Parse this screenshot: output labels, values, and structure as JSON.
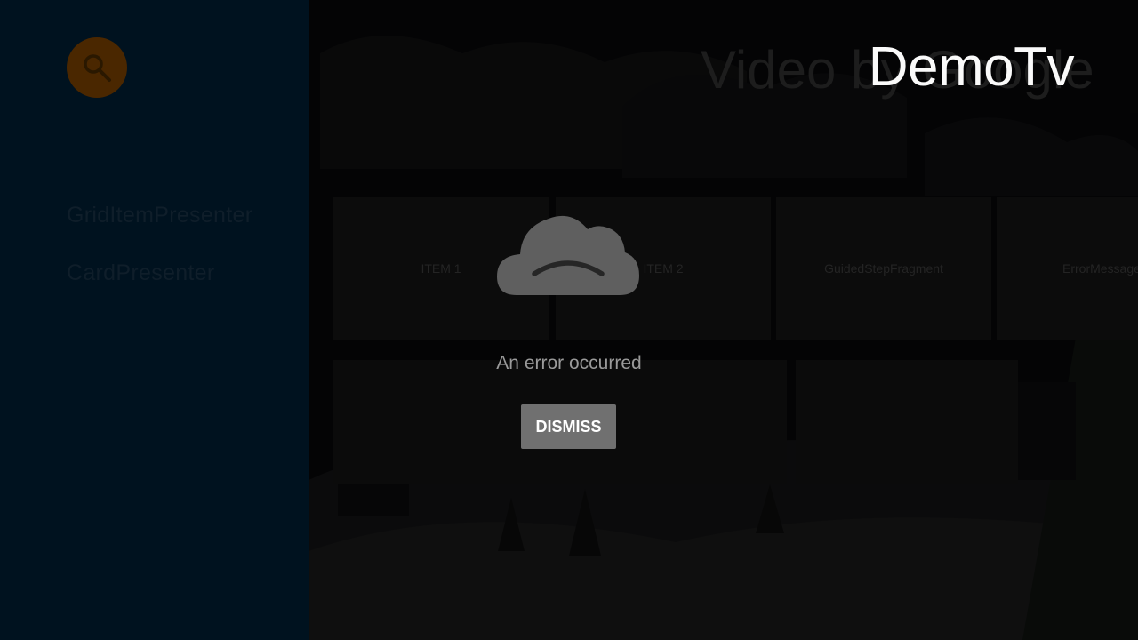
{
  "app": {
    "brand_title": "DemoTv",
    "ghost_title": "Video by Google"
  },
  "sidebar": {
    "search_icon": "search-icon",
    "items": [
      {
        "label": "GridItemPresenter"
      },
      {
        "label": "CardPresenter"
      }
    ]
  },
  "browse": {
    "row1_cards": [
      {
        "label": "ITEM 1"
      },
      {
        "label": "ITEM 2"
      },
      {
        "label": "GuidedStepFragment"
      },
      {
        "label": "ErrorMessage"
      }
    ]
  },
  "error": {
    "icon": "sad-cloud-icon",
    "message": "An error occurred",
    "dismiss_label": "DISMISS"
  },
  "colors": {
    "sidebar_bg": "#00121f",
    "search_orb": "#4a2700",
    "button_bg": "#707070"
  }
}
